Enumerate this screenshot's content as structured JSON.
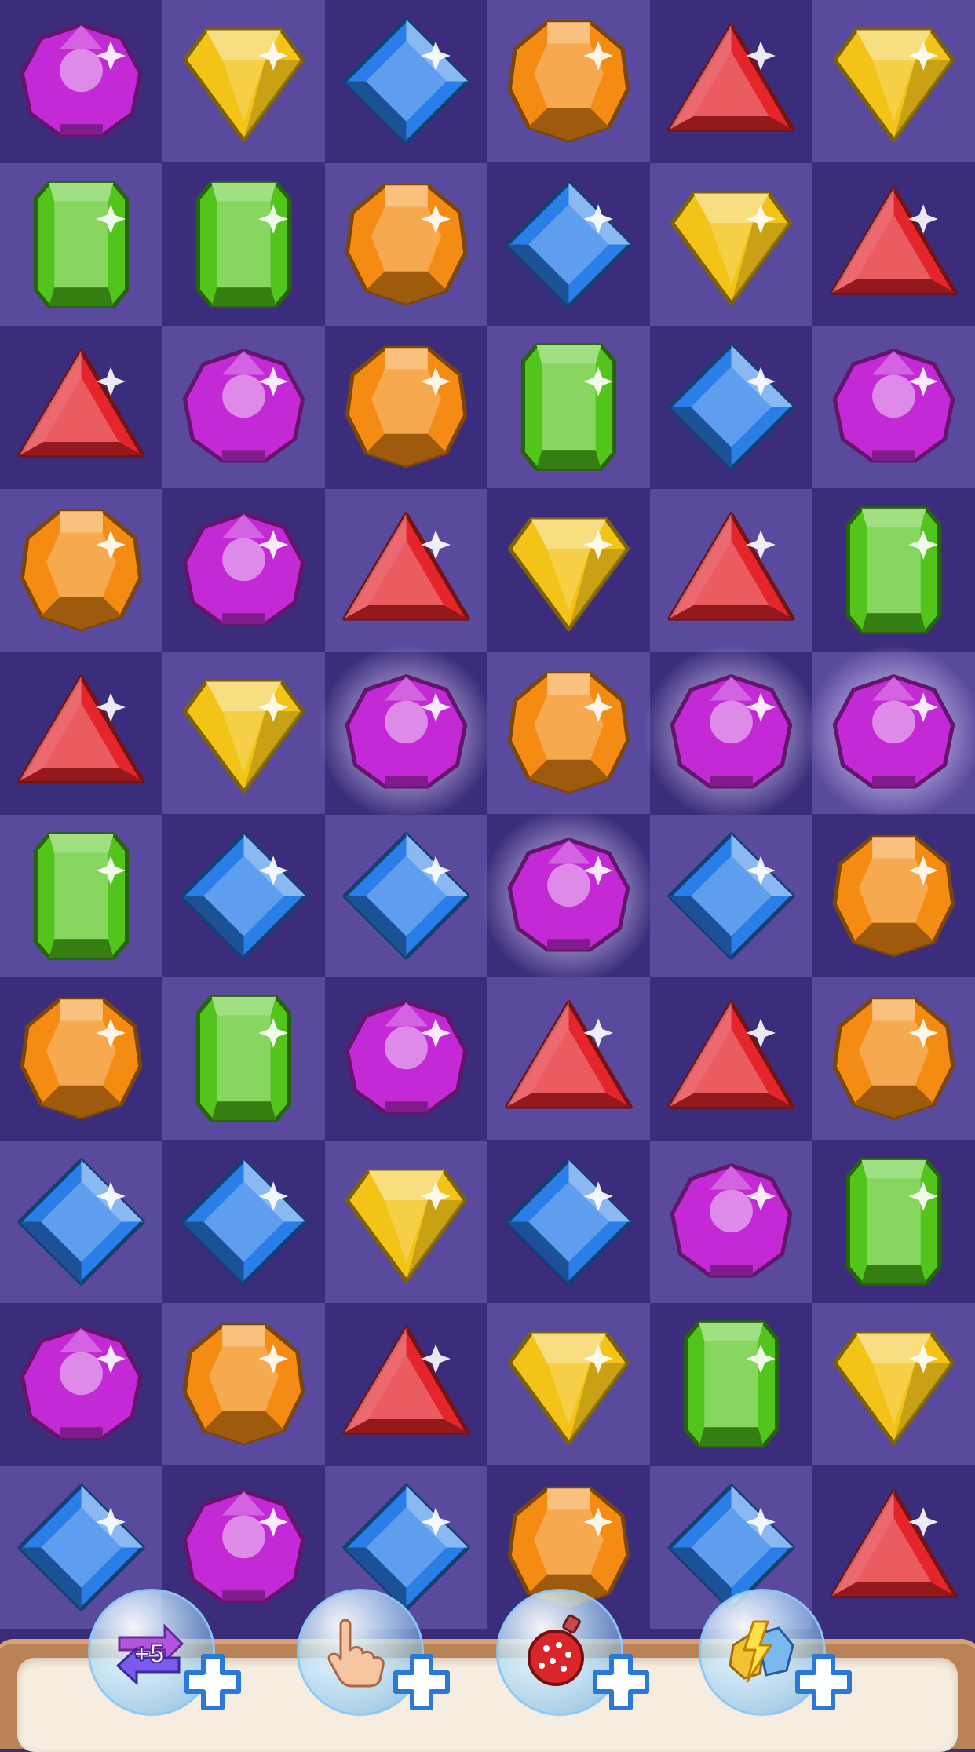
{
  "board": {
    "rows": 10,
    "cols": 6,
    "grid": [
      [
        "purple",
        "yellow",
        "blue",
        "orange",
        "red",
        "yellow"
      ],
      [
        "green",
        "green",
        "orange",
        "blue",
        "yellow",
        "red"
      ],
      [
        "red",
        "purple",
        "orange",
        "green",
        "blue",
        "purple"
      ],
      [
        "orange",
        "purple",
        "red",
        "yellow",
        "red",
        "green"
      ],
      [
        "red",
        "yellow",
        "purple",
        "orange",
        "purple",
        "purple"
      ],
      [
        "green",
        "blue",
        "blue",
        "purple",
        "blue",
        "orange"
      ],
      [
        "orange",
        "green",
        "purple",
        "red",
        "red",
        "orange"
      ],
      [
        "blue",
        "blue",
        "yellow",
        "blue",
        "purple",
        "green"
      ],
      [
        "purple",
        "orange",
        "red",
        "yellow",
        "green",
        "yellow"
      ],
      [
        "blue",
        "purple",
        "blue",
        "orange",
        "blue",
        "red"
      ]
    ],
    "highlighted": [
      [
        4,
        2
      ],
      [
        4,
        4
      ],
      [
        4,
        5
      ],
      [
        5,
        3
      ]
    ],
    "colors": {
      "dark_tile": "#3b2d7b",
      "light_tile": "#5a4a9e",
      "purple": "#c32ad6",
      "yellow": "#f3c318",
      "blue": "#2a7ee8",
      "orange": "#f48c14",
      "red": "#e4262c",
      "green": "#52c41c"
    }
  },
  "boosters": [
    {
      "name": "extra-moves",
      "label": "+5",
      "icon": "swap-arrows-icon"
    },
    {
      "name": "hand",
      "icon": "pointing-hand-icon"
    },
    {
      "name": "bomb",
      "icon": "bomb-icon"
    },
    {
      "name": "lightning",
      "icon": "lightning-gem-icon"
    }
  ]
}
